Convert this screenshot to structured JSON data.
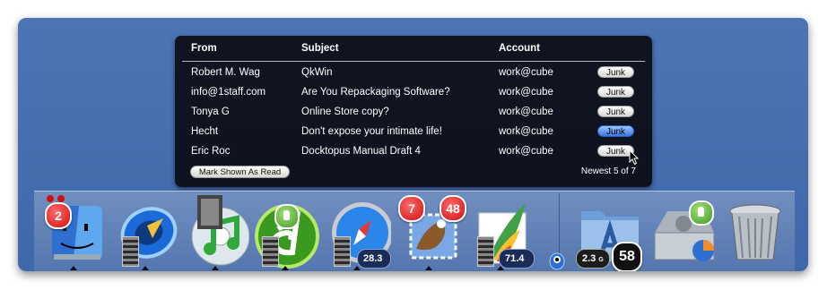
{
  "mail_popup": {
    "columns": {
      "from": "From",
      "subject": "Subject",
      "account": "Account"
    },
    "rows": [
      {
        "from": "Robert M. Wag",
        "subject": "QkWin",
        "account": "work@cube",
        "action": "Junk"
      },
      {
        "from": "info@1staff.com",
        "subject": "Are You Repackaging Software?",
        "account": "work@cube",
        "action": "Junk"
      },
      {
        "from": "Tonya G",
        "subject": "Online Store copy?",
        "account": "work@cube",
        "action": "Junk"
      },
      {
        "from": "Hecht",
        "subject": "Don't expose your intimate life!",
        "account": "work@cube",
        "action": "Junk"
      },
      {
        "from": "Eric Roc",
        "subject": "Docktopus Manual Draft 4",
        "account": "work@cube",
        "action": "Junk"
      }
    ],
    "mark_button": "Mark Shown As Read",
    "footer": "Newest 5 of 7"
  },
  "dock": {
    "items": [
      {
        "name": "finder",
        "badge": "2",
        "icon": "finder-icon"
      },
      {
        "name": "quicktime",
        "icon": "quicktime-icon"
      },
      {
        "name": "itunes",
        "icon": "itunes-icon"
      },
      {
        "name": "dreamweaver",
        "icon": "dreamweaver-icon"
      },
      {
        "name": "safari",
        "size_value": "28.3",
        "size_unit": "M",
        "icon": "safari-icon"
      },
      {
        "name": "mail",
        "badge_left": "7",
        "badge_right": "48",
        "icon": "mail-icon"
      },
      {
        "name": "image-viewer",
        "size_value": "71.4",
        "size_unit": "M",
        "icon": "paint-icon"
      },
      {
        "name": "applications-folder",
        "size_value": "2.3",
        "size_unit": "G",
        "count": "58",
        "icon": "folder-icon"
      },
      {
        "name": "hard-drive",
        "icon": "hard-drive-icon"
      },
      {
        "name": "trash",
        "icon": "trash-icon"
      }
    ]
  },
  "colors": {
    "window": "#4670b0",
    "popup": "#0c0e16",
    "badge_red": "#d10e0e",
    "junk_hot": "#3a78e0"
  }
}
